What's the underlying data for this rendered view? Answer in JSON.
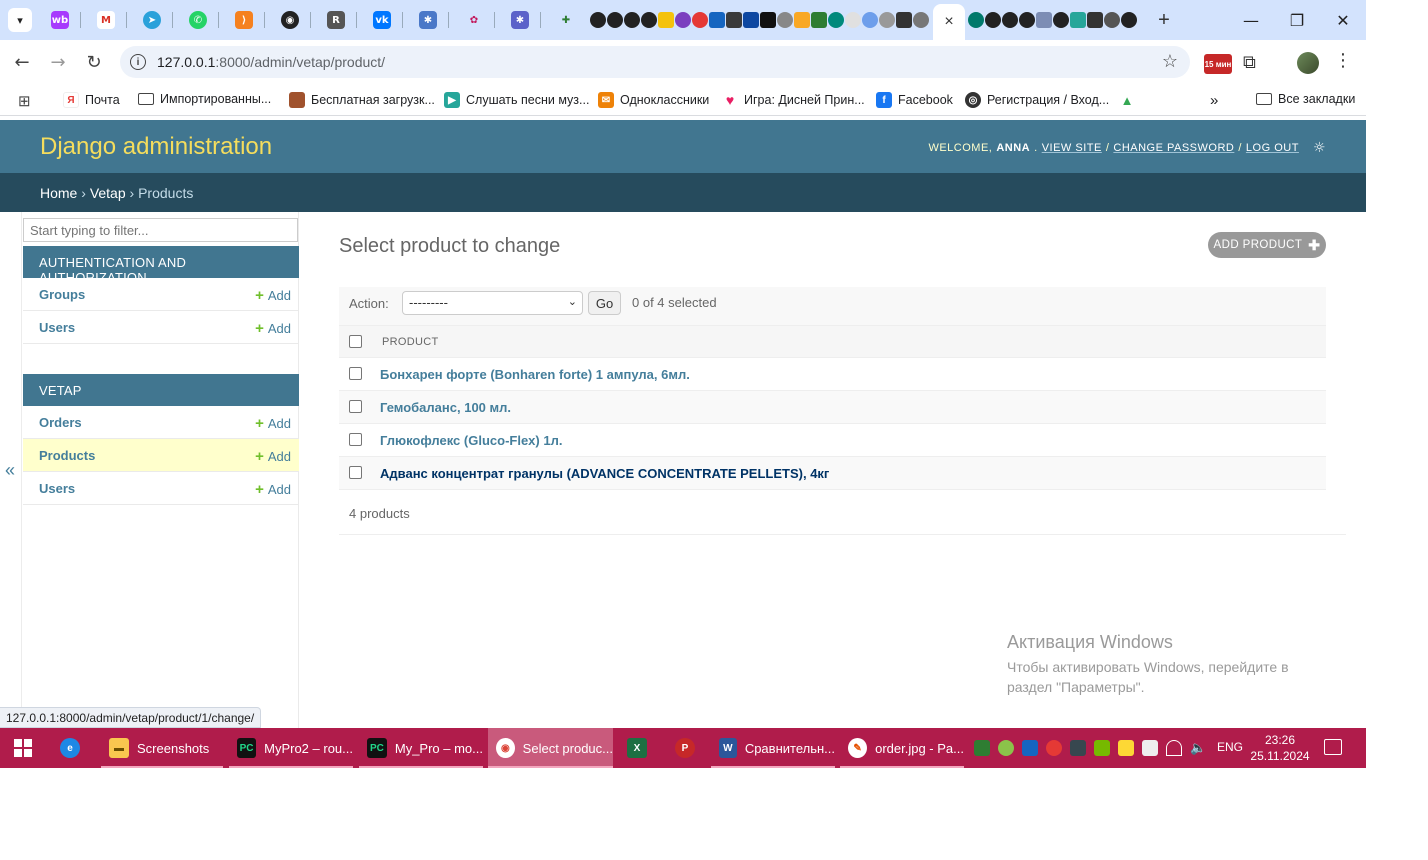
{
  "browser": {
    "active_tab_close": "×",
    "new_tab": "+",
    "window_controls": {
      "minimize": "—",
      "maximize": "❐",
      "close": "✕"
    },
    "url_host": "127.0.0.1",
    "url_path": ":8000/admin/vetap/product/",
    "extension_badge": "15 мин",
    "bookmarks": [
      {
        "label": "Почта",
        "icon": "yandex-icon"
      },
      {
        "label": "Импортированны...",
        "icon": "folder-icon"
      },
      {
        "label": "Бесплатная загрузк...",
        "icon": "image-icon"
      },
      {
        "label": "Слушать песни муз...",
        "icon": "music-icon"
      },
      {
        "label": "Одноклассники",
        "icon": "ok-icon"
      },
      {
        "label": "Игра: Дисней Прин...",
        "icon": "heart-icon"
      },
      {
        "label": "Facebook",
        "icon": "facebook-icon"
      },
      {
        "label": "Регистрация / Вход...",
        "icon": "globe-icon"
      }
    ],
    "bookmarks_more": "»",
    "all_bookmarks": "Все закладки"
  },
  "admin": {
    "site_title": "Django administration",
    "welcome": "WELCOME,",
    "username": "ANNA",
    "view_site": "VIEW SITE",
    "change_password": "CHANGE PASSWORD",
    "log_out": "LOG OUT",
    "breadcrumbs": {
      "home": "Home",
      "app": "Vetap",
      "current": "Products"
    }
  },
  "sidebar": {
    "filter_placeholder": "Start typing to filter...",
    "toggle": "«",
    "modules": [
      {
        "caption": "AUTHENTICATION AND AUTHORIZATION",
        "items": [
          {
            "label": "Groups",
            "add": "Add"
          },
          {
            "label": "Users",
            "add": "Add"
          }
        ]
      },
      {
        "caption": "VETAP",
        "items": [
          {
            "label": "Orders",
            "add": "Add"
          },
          {
            "label": "Products",
            "add": "Add"
          },
          {
            "label": "Users",
            "add": "Add"
          }
        ]
      }
    ]
  },
  "content": {
    "title": "Select product to change",
    "add_button": "ADD PRODUCT",
    "action_label": "Action:",
    "action_selected": "---------",
    "go": "Go",
    "selected_count": "0 of 4 selected",
    "column_header": "PRODUCT",
    "rows": [
      "Бонхарен форте (Bonharen forte) 1 ампула, 6мл.",
      "Гемобаланс, 100 мл.",
      "Глюкофлекс (Gluco-Flex) 1л.",
      "Адванс концентрат гранулы (ADVANCE CONCENTRATE PELLETS), 4кг"
    ],
    "paginator": "4 products"
  },
  "watermark": {
    "title": "Активация Windows",
    "text": "Чтобы активировать Windows, перейдите в раздел \"Параметры\"."
  },
  "status_bar_url": "127.0.0.1:8000/admin/vetap/product/1/change/",
  "taskbar": {
    "apps": [
      {
        "label": "Screenshots"
      },
      {
        "label": "MyPro2 – rou..."
      },
      {
        "label": "My_Pro – mo..."
      },
      {
        "label": "Select produc..."
      },
      {
        "label": "Сравнительн..."
      },
      {
        "label": "order.jpg - Pa..."
      }
    ],
    "language": "ENG",
    "time": "23:26",
    "date": "25.11.2024"
  },
  "colors": {
    "header": "#417690",
    "breadcrumbs": "#264b5d",
    "branding": "#f5dd5d",
    "link": "#447e9b",
    "add_green": "#70bf2b",
    "taskbar": "#b01c4b"
  }
}
